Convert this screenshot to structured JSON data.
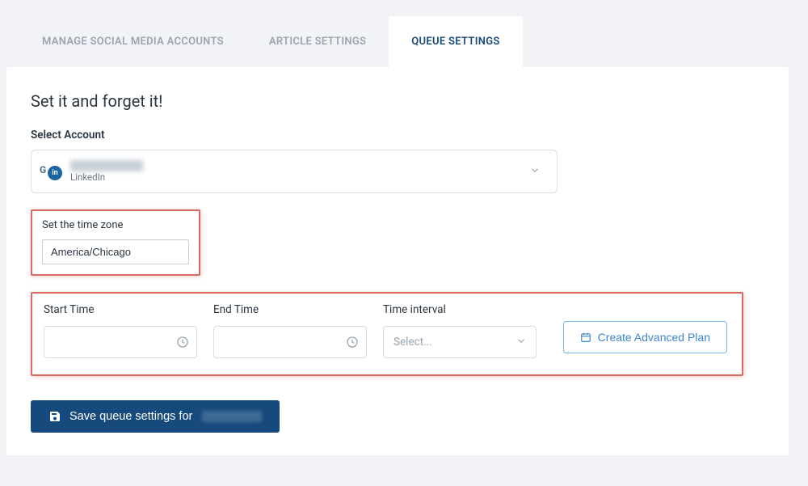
{
  "tabs": {
    "manage": "MANAGE SOCIAL MEDIA ACCOUNTS",
    "article": "ARTICLE SETTINGS",
    "queue": "QUEUE SETTINGS"
  },
  "heading": "Set it and forget it!",
  "account": {
    "label": "Select Account",
    "name": "",
    "sub": "LinkedIn",
    "in_badge": "in"
  },
  "timezone": {
    "label": "Set the time zone",
    "value": "America/Chicago"
  },
  "row": {
    "start_label": "Start Time",
    "end_label": "End Time",
    "interval_label": "Time interval",
    "interval_placeholder": "Select...",
    "advanced_label": "Create Advanced Plan"
  },
  "save": {
    "prefix": "Save queue settings for"
  }
}
